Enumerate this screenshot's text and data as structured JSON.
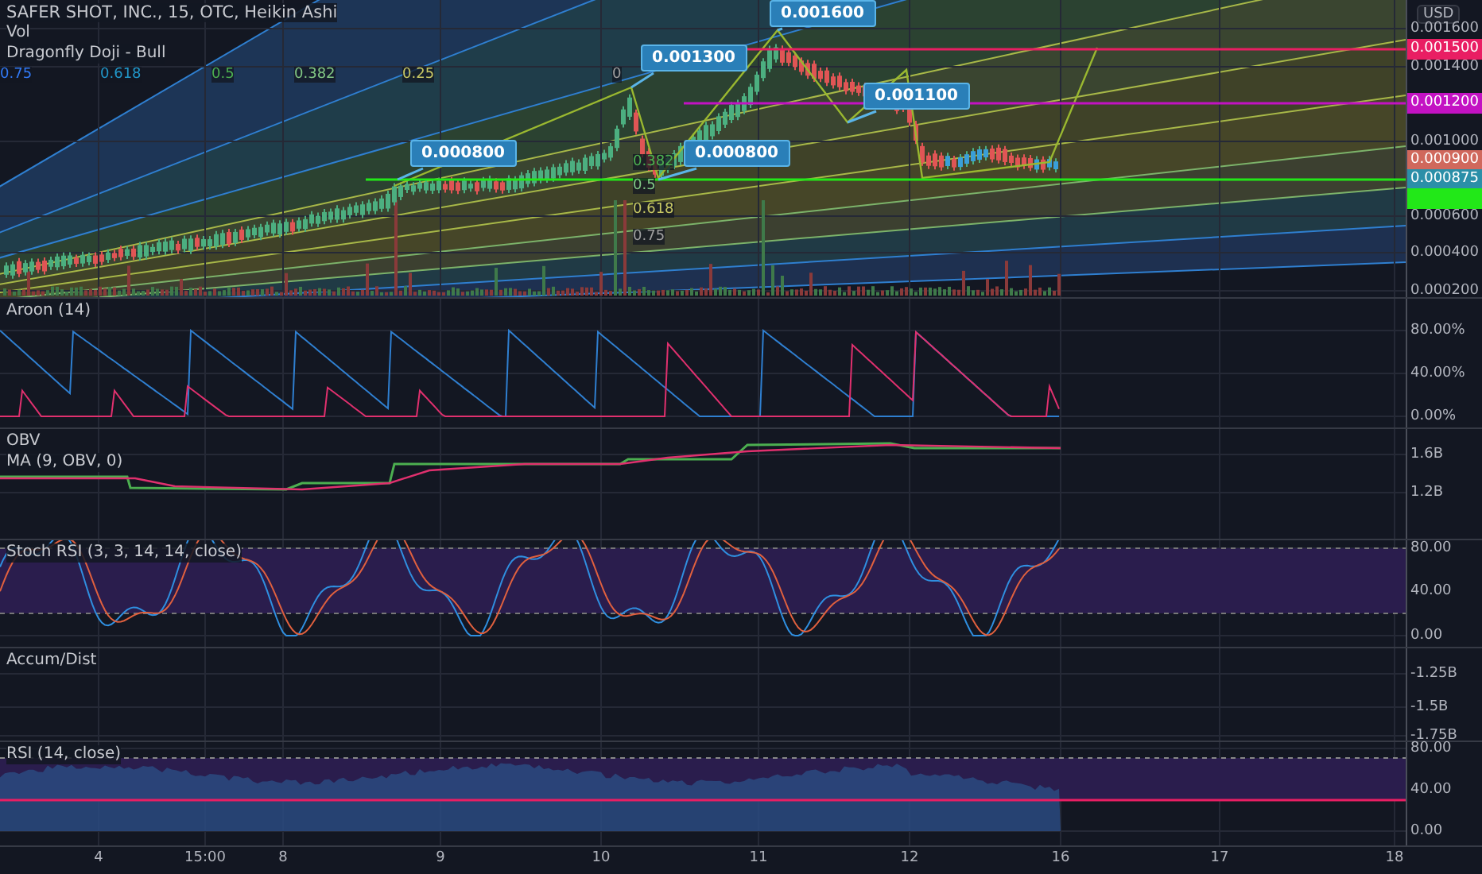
{
  "main": {
    "legend": [
      "SAFER SHOT, INC., 15, OTC, Heikin Ashi",
      "Vol",
      "Dragonfly Doji - Bull"
    ],
    "fib_labels": [
      "0.75",
      "0.618",
      "0.5",
      "0.382",
      "0.25",
      "0"
    ],
    "fib_side_labels": [
      "0.382",
      "0.5",
      "0.618",
      "0.75"
    ],
    "callouts": [
      "0.001600",
      "0.001300",
      "0.001100",
      "0.000800",
      "0.000800"
    ],
    "price_axis": {
      "unit": "USD",
      "ticks": [
        "0.001600",
        "0.001400",
        "0.001000",
        "0.000600",
        "0.000400",
        "0.000200"
      ],
      "tags": [
        {
          "text": "0.001500",
          "color": "#e91e63"
        },
        {
          "text": "0.001200",
          "color": "#c312c3"
        },
        {
          "text": "0.000900",
          "color": "#d0685c"
        },
        {
          "text": "0.000875",
          "color": "#2b8fa8"
        },
        {
          "color": "#22e818"
        }
      ]
    }
  },
  "panes": [
    {
      "kind": "aroon",
      "legend": [
        "Aroon (14)"
      ],
      "ticks": [
        "80.00%",
        "40.00%",
        "0.00%"
      ]
    },
    {
      "kind": "obv",
      "legend": [
        "OBV",
        "MA (9, OBV, 0)"
      ],
      "ticks": [
        "1.6B",
        "1.2B"
      ]
    },
    {
      "kind": "stoch",
      "legend": [
        "Stoch RSI (3, 3, 14, 14, close)"
      ],
      "ticks": [
        "80.00",
        "40.00",
        "0.00"
      ]
    },
    {
      "kind": "accum",
      "legend": [
        "Accum/Dist"
      ],
      "ticks": [
        "-1.25B",
        "-1.5B",
        "-1.75B"
      ]
    },
    {
      "kind": "rsi",
      "legend": [
        "RSI (14, close)"
      ],
      "ticks": [
        "80.00",
        "40.00",
        "0.00"
      ]
    }
  ],
  "time_axis": [
    "4",
    "15:00",
    "8",
    "9",
    "10",
    "11",
    "12",
    "16",
    "17",
    "18"
  ]
}
